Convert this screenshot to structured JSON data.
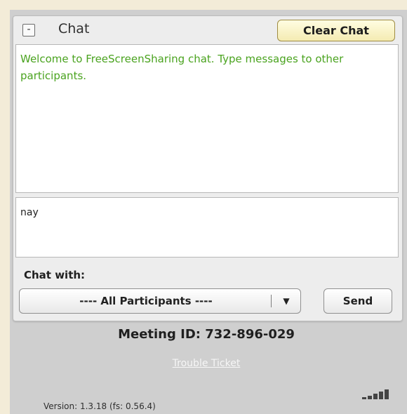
{
  "chat": {
    "title": "Chat",
    "collapse_symbol": "-",
    "clear_label": "Clear Chat",
    "welcome_message": "Welcome to FreeScreenSharing chat. Type messages to other participants.",
    "input_value": "nay",
    "chat_with_label": "Chat with:",
    "selected_participant": "---- All Participants ----",
    "dropdown_arrow": "▼",
    "send_label": "Send"
  },
  "footer": {
    "meeting_id_text": "Meeting ID:  732-896-029",
    "trouble_ticket_label": "Trouble Ticket",
    "version_text": "Version: 1.3.18 (fs: 0.56.4)"
  },
  "status": {
    "signal_icon": "signal-strength-icon"
  }
}
